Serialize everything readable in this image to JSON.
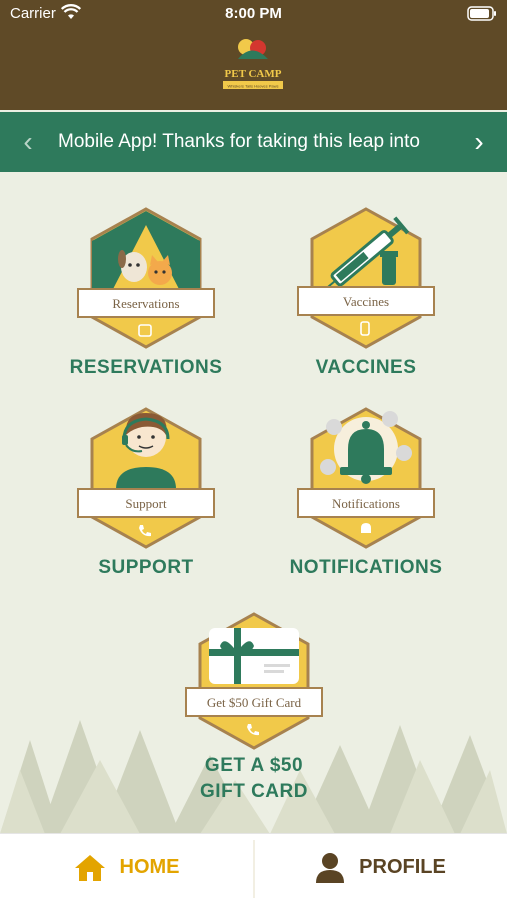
{
  "status_bar": {
    "carrier": "Carrier",
    "time": "8:00 PM"
  },
  "header": {
    "logo_text": "PET CAMP",
    "logo_tagline": "Whiskers Tails Hooves Paws"
  },
  "banner": {
    "text": "Mobile App!  Thanks for taking this leap into",
    "prev_icon": "chevron-left-icon",
    "next_icon": "chevron-right-icon"
  },
  "tiles": {
    "reservations": {
      "badge": "Reservations",
      "caption": "RESERVATIONS"
    },
    "vaccines": {
      "badge": "Vaccines",
      "caption": "VACCINES"
    },
    "support": {
      "badge": "Support",
      "caption": "SUPPORT"
    },
    "notifications": {
      "badge": "Notifications",
      "caption": "NOTIFICATIONS"
    },
    "gift": {
      "badge": "Get $50 Gift Card",
      "caption_line1": "GET A $50",
      "caption_line2": "GIFT CARD"
    }
  },
  "tabbar": {
    "home": "HOME",
    "profile": "PROFILE"
  },
  "colors": {
    "header_brown": "#5f4a27",
    "banner_green": "#2e7a5c",
    "badge_yellow": "#f1c94a",
    "home_active": "#e3a400",
    "background": "#ecefe3"
  }
}
